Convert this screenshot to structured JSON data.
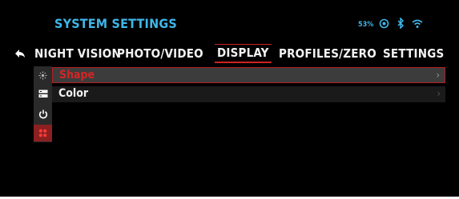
{
  "header": {
    "title": "SYSTEM SETTINGS",
    "battery_label": "53%"
  },
  "status_icons": [
    "target-icon",
    "bluetooth-icon",
    "wifi-icon"
  ],
  "nav": {
    "tabs": [
      {
        "label": "NIGHT VISION",
        "active": false
      },
      {
        "label": "PHOTO/VIDEO",
        "active": false
      },
      {
        "label": "DISPLAY",
        "active": true
      },
      {
        "label": "PROFILES/ZERO",
        "active": false
      },
      {
        "label": "SETTINGS",
        "active": false
      }
    ]
  },
  "sidebar": {
    "icons": [
      "brightness-icon",
      "storage-icon",
      "power-icon",
      "grid-dots-icon"
    ],
    "active_index": 3
  },
  "menu": {
    "items": [
      {
        "label": "Shape",
        "selected": true
      },
      {
        "label": "Color",
        "selected": false
      }
    ]
  },
  "colors": {
    "accent_blue": "#3fb6e8",
    "accent_red": "#cc2222",
    "background": "#000000"
  }
}
